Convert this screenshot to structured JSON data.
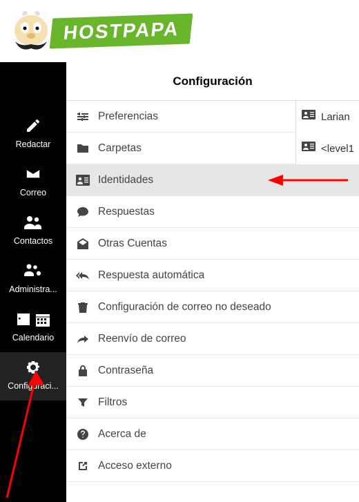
{
  "logo": {
    "text": "HOSTPAPA"
  },
  "sidebar": {
    "items": [
      {
        "label": "Redactar",
        "icon": "compose"
      },
      {
        "label": "Correo",
        "icon": "mail"
      },
      {
        "label": "Contactos",
        "icon": "contacts"
      },
      {
        "label": "Administra...",
        "icon": "admin"
      },
      {
        "label": "Calendario",
        "icon": "calendar"
      },
      {
        "label": "Configuraci...",
        "icon": "gear"
      }
    ],
    "active_index": 5
  },
  "settings": {
    "header": "Configuración",
    "items": [
      {
        "label": "Preferencias",
        "icon": "sliders"
      },
      {
        "label": "Carpetas",
        "icon": "folder"
      },
      {
        "label": "Identidades",
        "icon": "id-card"
      },
      {
        "label": "Respuestas",
        "icon": "comment"
      },
      {
        "label": "Otras Cuentas",
        "icon": "envelope-open"
      },
      {
        "label": "Respuesta automática",
        "icon": "reply-all"
      },
      {
        "label": "Configuración de correo no deseado",
        "icon": "trash"
      },
      {
        "label": "Reenvío de correo",
        "icon": "forward"
      },
      {
        "label": "Contraseña",
        "icon": "lock"
      },
      {
        "label": "Filtros",
        "icon": "filter"
      },
      {
        "label": "Acerca de",
        "icon": "question"
      },
      {
        "label": "Acceso externo",
        "icon": "external"
      }
    ],
    "selected_index": 2
  },
  "identities": {
    "items": [
      {
        "label": "Larian"
      },
      {
        "label": "<level1"
      }
    ]
  },
  "annotations": {
    "arrows": [
      "arrow-to-identities",
      "arrow-to-settings-gear"
    ]
  }
}
